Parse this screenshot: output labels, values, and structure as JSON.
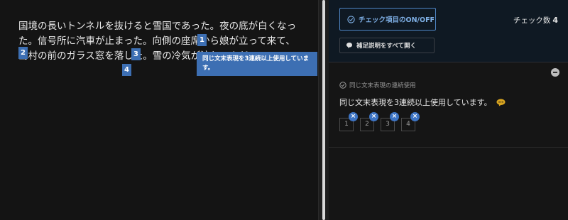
{
  "editor": {
    "text": "国境の長いトンネルを抜けると雪国であった。夜の底が白くなった。信号所に汽車が止まった。向側の座席から娘が立って来て、島村の前のガラス窓を落した。雪の冷気が流れこんだ。",
    "markers": [
      "1",
      "2",
      "3",
      "4"
    ],
    "tooltip": "同じ文末表現を3連続以上使用しています。"
  },
  "panel": {
    "toggle_label": "チェック項目のON/OFF",
    "count_label": "チェック数",
    "count_value": "4",
    "expand_label": "補足説明をすべて開く",
    "issue": {
      "category": "同じ文末表現の連続使用",
      "message": "同じ文末表現を3連続以上使用しています。",
      "chips": [
        "1",
        "2",
        "3",
        "4"
      ],
      "chip_remove": "×"
    }
  },
  "colors": {
    "accent": "#3d6fb3",
    "comment": "#d9a520"
  }
}
